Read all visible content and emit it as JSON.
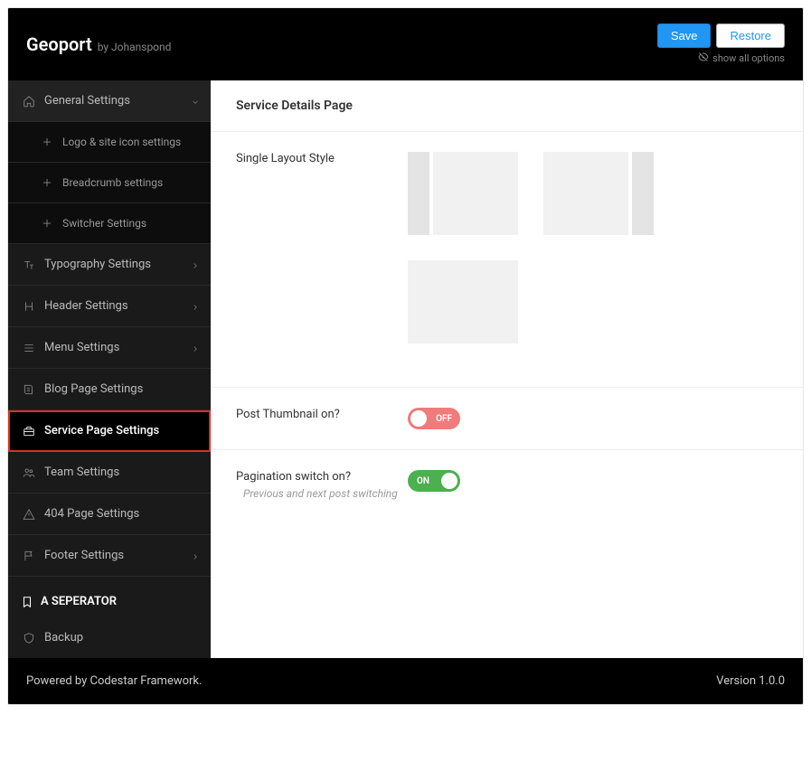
{
  "header": {
    "brand": "Geoport",
    "by": "by Johanspond",
    "save": "Save",
    "restore": "Restore",
    "show_all": "show all options"
  },
  "sidebar": {
    "general": "General Settings",
    "general_sub": {
      "logo": "Logo & site icon settings",
      "breadcrumb": "Breadcrumb settings",
      "switcher": "Switcher Settings"
    },
    "typography": "Typography Settings",
    "header_s": "Header Settings",
    "menu": "Menu Settings",
    "blog": "Blog Page Settings",
    "service": "Service Page Settings",
    "team": "Team Settings",
    "p404": "404 Page Settings",
    "footer_s": "Footer Settings",
    "separator": "A SEPERATOR",
    "backup": "Backup"
  },
  "content": {
    "title": "Service Details Page",
    "single_layout": "Single Layout Style",
    "post_thumb": "Post Thumbnail on?",
    "pagination": "Pagination switch on?",
    "pagination_sub": "Previous and next post switching",
    "toggle_on": "ON",
    "toggle_off": "OFF"
  },
  "footer": {
    "powered": "Powered by Codestar Framework.",
    "version": "Version 1.0.0"
  }
}
